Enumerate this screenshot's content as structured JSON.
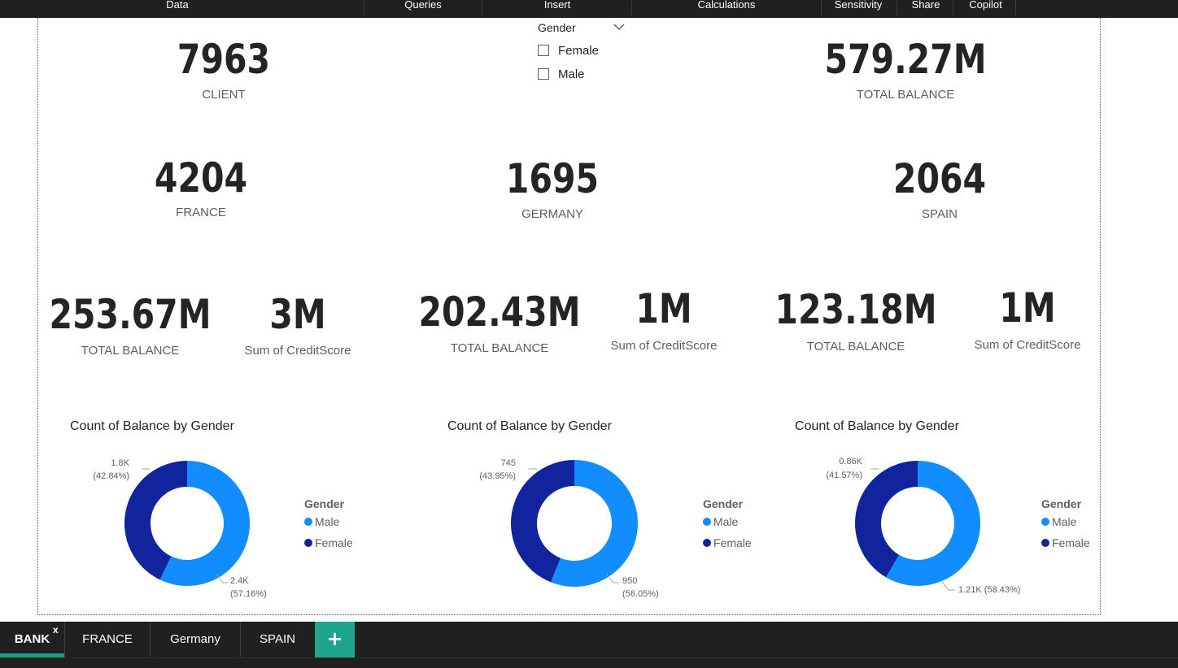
{
  "ribbon": {
    "items": [
      "Data",
      "Queries",
      "Insert",
      "Calculations",
      "Sensitivity",
      "Share",
      "Copilot"
    ]
  },
  "slicer": {
    "title": "Gender",
    "options": [
      "Female",
      "Male"
    ],
    "icon": "chevron-down-icon"
  },
  "kpis": {
    "client": {
      "value": "7963",
      "label": "CLIENT"
    },
    "total_balance": {
      "value": "579.27M",
      "label": "TOTAL BALANCE"
    },
    "france": {
      "value": "4204",
      "label": "FRANCE"
    },
    "germany": {
      "value": "1695",
      "label": "GERMANY"
    },
    "spain": {
      "value": "2064",
      "label": "SPAIN"
    },
    "france_balance": {
      "value": "253.67M",
      "label": "TOTAL BALANCE"
    },
    "france_credit": {
      "value": "3M",
      "label": "Sum of CreditScore"
    },
    "germany_balance": {
      "value": "202.43M",
      "label": "TOTAL BALANCE"
    },
    "germany_credit": {
      "value": "1M",
      "label": "Sum of CreditScore"
    },
    "spain_balance": {
      "value": "123.18M",
      "label": "TOTAL BALANCE"
    },
    "spain_credit": {
      "value": "1M",
      "label": "Sum of CreditScore"
    }
  },
  "legend": {
    "title": "Gender",
    "items": [
      "Male",
      "Female"
    ]
  },
  "colors": {
    "male": "#118dff",
    "female": "#12239e",
    "accent_tab": "#16a085"
  },
  "chart_data": [
    {
      "type": "pie",
      "title": "Count of Balance by Gender",
      "categories": [
        "Male",
        "Female"
      ],
      "values": [
        2400,
        1800
      ],
      "percents": [
        57.16,
        42.84
      ],
      "data_labels": [
        "2.4K",
        "(57.16%)",
        "1.8K",
        "(42.84%)"
      ],
      "legend_title": "Gender",
      "legend_position": "right",
      "donut": true
    },
    {
      "type": "pie",
      "title": "Count of Balance by Gender",
      "categories": [
        "Male",
        "Female"
      ],
      "values": [
        950,
        745
      ],
      "percents": [
        56.05,
        43.95
      ],
      "data_labels": [
        "950",
        "(56.05%)",
        "745",
        "(43.95%)"
      ],
      "legend_title": "Gender",
      "legend_position": "right",
      "donut": true
    },
    {
      "type": "pie",
      "title": "Count of Balance by Gender",
      "categories": [
        "Male",
        "Female"
      ],
      "values": [
        1210,
        860
      ],
      "percents": [
        58.43,
        41.57
      ],
      "data_labels": [
        "1.21K (58.43%)",
        "",
        "0.86K",
        "(41.57%)"
      ],
      "legend_title": "Gender",
      "legend_position": "right",
      "donut": true
    }
  ],
  "tabs": {
    "items": [
      "BANK",
      "FRANCE",
      "Germany",
      "SPAIN"
    ],
    "active": "BANK",
    "close_glyph": "x",
    "add_glyph": "+"
  }
}
